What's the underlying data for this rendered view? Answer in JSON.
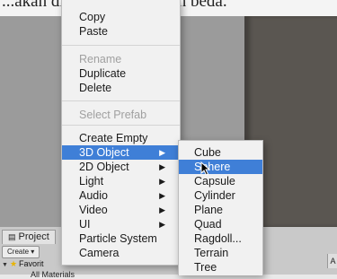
{
  "caption": "...akan ditampilkan dengan beda.",
  "main_menu": {
    "items": [
      {
        "label": "Copy",
        "enabled": true
      },
      {
        "label": "Paste",
        "enabled": true
      },
      {
        "label": "Rename",
        "enabled": false
      },
      {
        "label": "Duplicate",
        "enabled": true
      },
      {
        "label": "Delete",
        "enabled": true
      },
      {
        "label": "Select Prefab",
        "enabled": false
      },
      {
        "label": "Create Empty",
        "enabled": true
      },
      {
        "label": "3D Object",
        "enabled": true,
        "submenu": true,
        "active": true
      },
      {
        "label": "2D Object",
        "enabled": true,
        "submenu": true
      },
      {
        "label": "Light",
        "enabled": true,
        "submenu": true
      },
      {
        "label": "Audio",
        "enabled": true,
        "submenu": true
      },
      {
        "label": "Video",
        "enabled": true,
        "submenu": true
      },
      {
        "label": "UI",
        "enabled": true,
        "submenu": true
      },
      {
        "label": "Particle System",
        "enabled": true
      },
      {
        "label": "Camera",
        "enabled": true
      }
    ],
    "arrow_glyph": "▶"
  },
  "sub_menu": {
    "items": [
      {
        "label": "Cube"
      },
      {
        "label": "Sphere",
        "active": true
      },
      {
        "label": "Capsule"
      },
      {
        "label": "Cylinder"
      },
      {
        "label": "Plane"
      },
      {
        "label": "Quad"
      },
      {
        "label": "Ragdoll..."
      },
      {
        "label": "Terrain"
      },
      {
        "label": "Tree"
      }
    ]
  },
  "project_panel": {
    "tab_label": "Project",
    "create_button": "Create ▾",
    "favorites_label": "Favorit",
    "all_materials": "All Materials",
    "side_letter": "A"
  },
  "colors": {
    "highlight": "#3f7fd7",
    "menu_bg": "#f1f1f1",
    "disabled_text": "#a0a0a0",
    "star": "#e8b400"
  },
  "icons": {
    "submenu_arrow": "chevron-right-icon",
    "folder_star": "star-icon",
    "cursor": "mouse-pointer-icon"
  }
}
